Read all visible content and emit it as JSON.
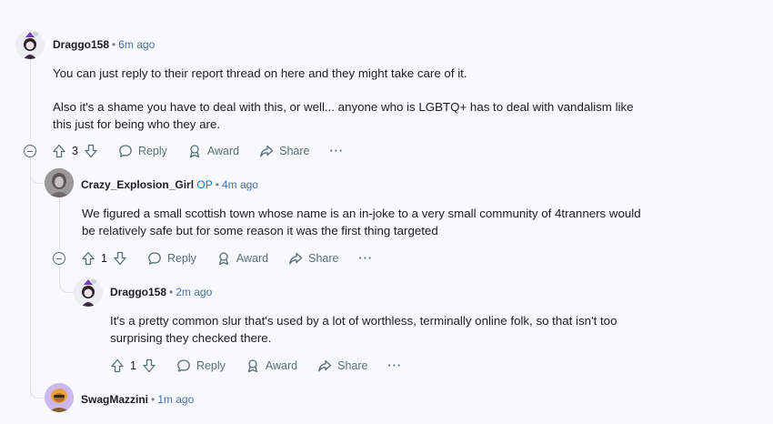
{
  "comments": [
    {
      "author": "Draggo158",
      "time": "6m ago",
      "paragraphs": [
        "You can just reply to their report thread on here and they might take care of it.",
        "Also it's a shame you have to deal with this, or well... anyone who is LGBTQ+ has to deal with vandalism like this just for being who they are."
      ],
      "votes": "3"
    },
    {
      "author": "Crazy_Explosion_Girl",
      "op_label": "OP",
      "time": "4m ago",
      "paragraphs": [
        "We figured a small scottish town whose name is an in-joke to a very small community of 4tranners would be relatively safe but for some reason it was the first thing targeted"
      ],
      "votes": "1"
    },
    {
      "author": "Draggo158",
      "time": "2m ago",
      "paragraphs": [
        "It's a pretty common slur that's used by a lot of worthless, terminally online folk, so that isn't too surprising they checked there."
      ],
      "votes": "1"
    },
    {
      "author": "SwagMazzini",
      "time": "1m ago"
    }
  ],
  "actions": {
    "reply": "Reply",
    "award": "Award",
    "share": "Share",
    "more": "···"
  },
  "icons": [
    "upvote-icon",
    "downvote-icon",
    "reply-icon",
    "award-icon",
    "share-icon",
    "more-icon",
    "collapse-icon"
  ],
  "colors": {
    "background": "#f8f9fd",
    "link_blue": "#0079d3",
    "action_gray": "#576f76"
  }
}
